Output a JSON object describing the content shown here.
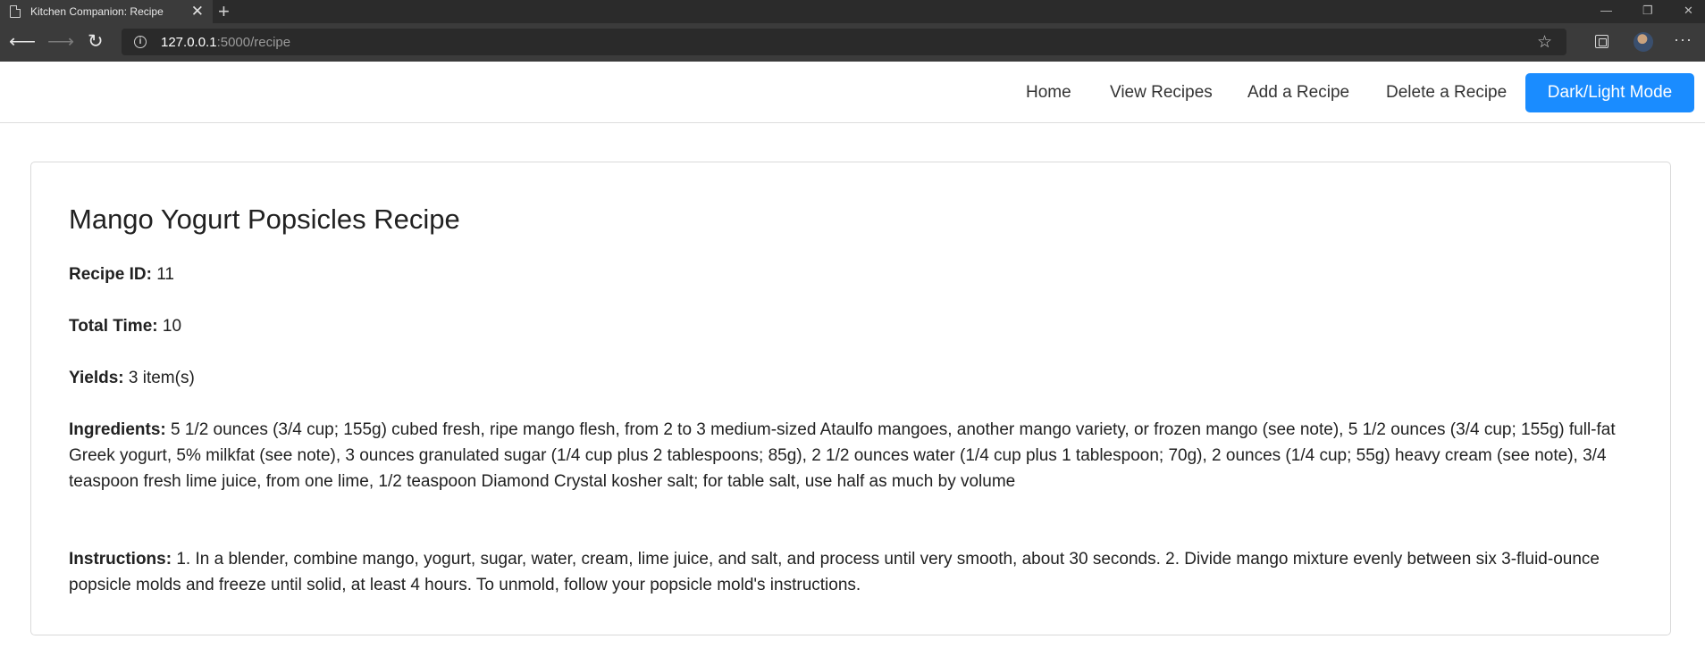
{
  "browser": {
    "tab_title": "Kitchen Companion: Recipe",
    "tab_close": "✕",
    "new_tab": "+",
    "url_host": "127.0.0.1",
    "url_path": ":5000/recipe"
  },
  "nav": {
    "home": "Home",
    "view_recipes": "View Recipes",
    "add_recipe": "Add a Recipe",
    "delete_recipe": "Delete a Recipe",
    "mode_toggle": "Dark/Light Mode"
  },
  "recipe": {
    "title": "Mango Yogurt Popsicles Recipe",
    "id_label": "Recipe ID:",
    "id": "11",
    "time_label": "Total Time:",
    "total_time": "10",
    "yields_label": "Yields:",
    "yields": "3 item(s)",
    "ingredients_label": "Ingredients:",
    "ingredients": "5 1/2 ounces (3/4 cup; 155g) cubed fresh, ripe mango flesh, from 2 to 3 medium-sized Ataulfo mangoes, another mango variety, or frozen mango (see note), 5 1/2 ounces (3/4 cup; 155g) full-fat Greek yogurt, 5% milkfat (see note), 3 ounces granulated sugar (1/4 cup plus 2 tablespoons; 85g), 2 1/2 ounces water (1/4 cup plus 1 tablespoon; 70g), 2 ounces (1/4 cup; 55g) heavy cream (see note), 3/4 teaspoon fresh lime juice, from one lime, 1/2 teaspoon Diamond Crystal kosher salt; for table salt, use half as much by volume",
    "instructions_label": "Instructions:",
    "instructions": "1. In a blender, combine mango, yogurt, sugar, water, cream, lime juice, and salt, and process until very smooth, about 30 seconds. 2. Divide mango mixture evenly between six 3-fluid-ounce popsicle molds and freeze until solid, at least 4 hours. To unmold, follow your popsicle mold's instructions."
  },
  "colors": {
    "accent": "#1a8cff",
    "chrome": "#3b3b3b"
  }
}
